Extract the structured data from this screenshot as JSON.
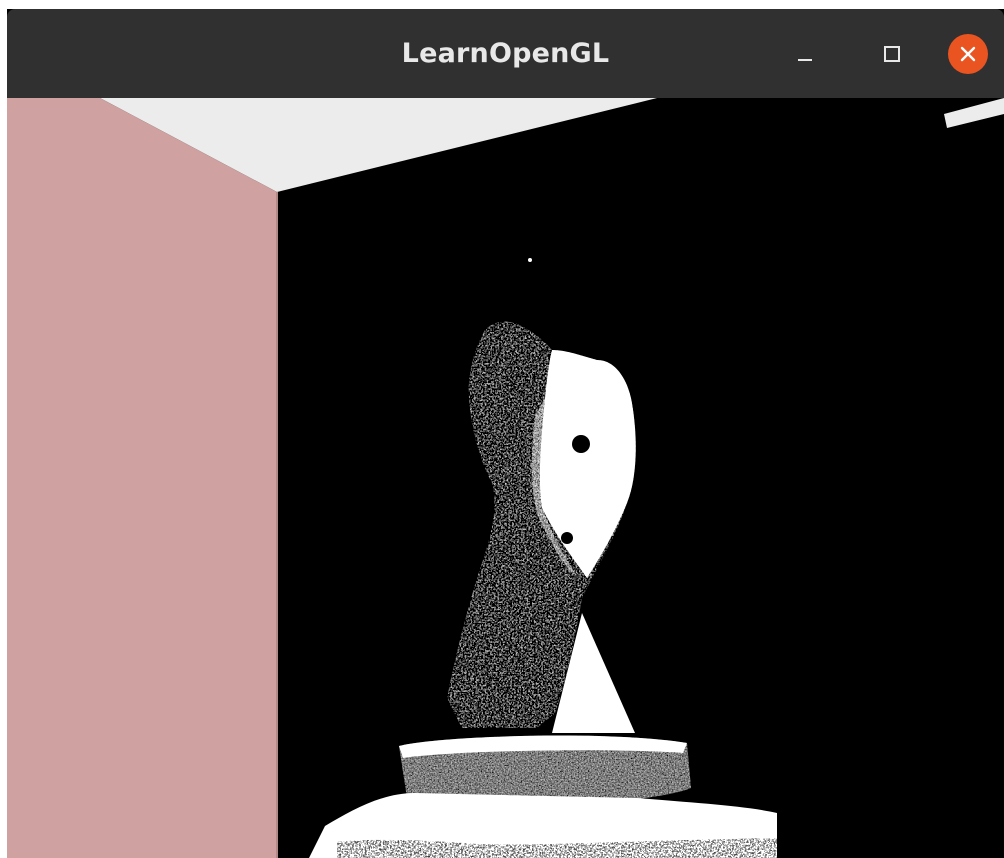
{
  "window": {
    "title": "LearnOpenGL",
    "controls": {
      "minimize_icon": "minimize-icon",
      "maximize_icon": "maximize-icon",
      "close_icon": "close-icon"
    },
    "colors": {
      "titlebar": "#303030",
      "title_text": "#e8e8e8",
      "close_button": "#e95420"
    }
  },
  "scene": {
    "colors": {
      "left_wall": "#cfa1a0",
      "ceiling": "#ececec",
      "background": "#000000",
      "highlight": "#ffffff"
    }
  }
}
